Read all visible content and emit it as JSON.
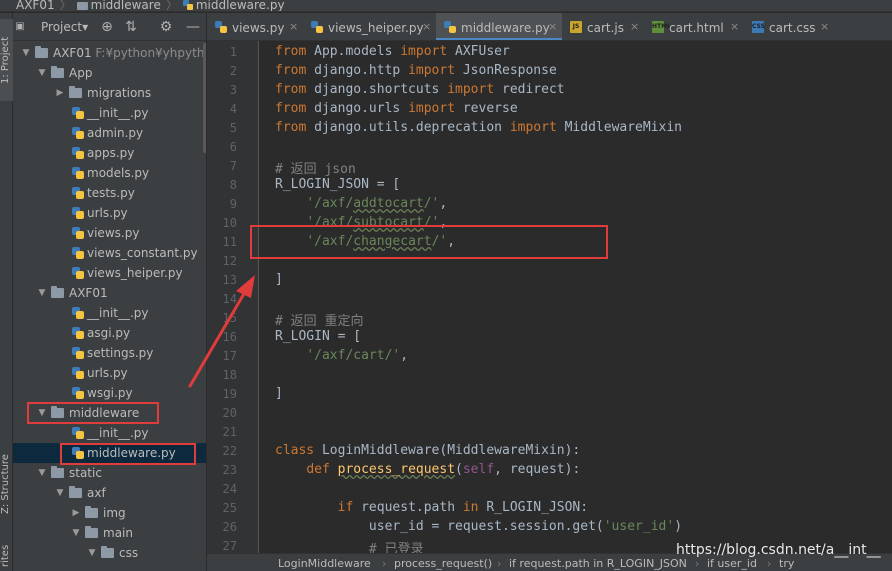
{
  "breadcrumb": {
    "project": "AXF01",
    "folder": "middleware",
    "file": "middleware.py"
  },
  "side_tabs": {
    "project": "1: Project",
    "structure": "Z: Structure",
    "favorites": "rites"
  },
  "project_panel": {
    "title": "Project",
    "title_arrow": "▾",
    "tools": {
      "locate": "⊕",
      "collapse": "⇅",
      "settings": "⚙",
      "hide": "—"
    }
  },
  "tree": [
    {
      "label": "AXF01",
      "path": "F:¥python¥yhpython¥",
      "type": "folder",
      "depth": 0,
      "expanded": true
    },
    {
      "label": "App",
      "type": "folder",
      "depth": 1,
      "expanded": true
    },
    {
      "label": "migrations",
      "type": "folder",
      "depth": 2,
      "expanded": false
    },
    {
      "label": "__init__.py",
      "type": "py",
      "depth": 3
    },
    {
      "label": "admin.py",
      "type": "py",
      "depth": 3
    },
    {
      "label": "apps.py",
      "type": "py",
      "depth": 3
    },
    {
      "label": "models.py",
      "type": "py",
      "depth": 3
    },
    {
      "label": "tests.py",
      "type": "py",
      "depth": 3
    },
    {
      "label": "urls.py",
      "type": "py",
      "depth": 3
    },
    {
      "label": "views.py",
      "type": "py",
      "depth": 3
    },
    {
      "label": "views_constant.py",
      "type": "py",
      "depth": 3
    },
    {
      "label": "views_heiper.py",
      "type": "py",
      "depth": 3
    },
    {
      "label": "AXF01",
      "type": "folder",
      "depth": 1,
      "expanded": true
    },
    {
      "label": "__init__.py",
      "type": "py",
      "depth": 3
    },
    {
      "label": "asgi.py",
      "type": "py",
      "depth": 3
    },
    {
      "label": "settings.py",
      "type": "py",
      "depth": 3
    },
    {
      "label": "urls.py",
      "type": "py",
      "depth": 3
    },
    {
      "label": "wsgi.py",
      "type": "py",
      "depth": 3
    },
    {
      "label": "middleware",
      "type": "folder",
      "depth": 1,
      "expanded": true
    },
    {
      "label": "__init__.py",
      "type": "py",
      "depth": 3
    },
    {
      "label": "middleware.py",
      "type": "py",
      "depth": 3,
      "selected": true
    },
    {
      "label": "static",
      "type": "folder",
      "depth": 1,
      "expanded": true
    },
    {
      "label": "axf",
      "type": "folder",
      "depth": 2,
      "expanded": true
    },
    {
      "label": "img",
      "type": "folder",
      "depth": 3,
      "expanded": false
    },
    {
      "label": "main",
      "type": "folder",
      "depth": 3,
      "expanded": true
    },
    {
      "label": "css",
      "type": "folder",
      "depth": 4,
      "expanded": true
    }
  ],
  "tabs": [
    {
      "label": "views.py",
      "icon": "python-file-icon",
      "active": false
    },
    {
      "label": "views_heiper.py",
      "icon": "python-file-icon",
      "active": false
    },
    {
      "label": "middleware.py",
      "icon": "python-file-icon",
      "active": true
    },
    {
      "label": "cart.js",
      "icon": "js-file-icon",
      "active": false
    },
    {
      "label": "cart.html",
      "icon": "html-file-icon",
      "active": false
    },
    {
      "label": "cart.css",
      "icon": "css-file-icon",
      "active": false
    }
  ],
  "tab_close": "×",
  "code_lines": [
    [
      [
        "kw",
        "from"
      ],
      [
        "p",
        " App.models "
      ],
      [
        "kw",
        "import"
      ],
      [
        "p",
        " AXFUser"
      ]
    ],
    [
      [
        "kw",
        "from"
      ],
      [
        "p",
        " django.http "
      ],
      [
        "kw",
        "import"
      ],
      [
        "p",
        " JsonResponse"
      ]
    ],
    [
      [
        "kw",
        "from"
      ],
      [
        "p",
        " django.shortcuts "
      ],
      [
        "kw",
        "import"
      ],
      [
        "p",
        " redirect"
      ]
    ],
    [
      [
        "kw",
        "from"
      ],
      [
        "p",
        " django.urls "
      ],
      [
        "kw",
        "import"
      ],
      [
        "p",
        " reverse"
      ]
    ],
    [
      [
        "kw",
        "from"
      ],
      [
        "p",
        " django.utils.deprecation "
      ],
      [
        "kw",
        "import"
      ],
      [
        "p",
        " MiddlewareMixin"
      ]
    ],
    [],
    [
      [
        "cm",
        "# 返回 json"
      ]
    ],
    [
      [
        "p",
        "R_LOGIN_JSON = ["
      ]
    ],
    [
      [
        "p",
        "    "
      ],
      [
        "str",
        "'/axf/"
      ],
      [
        "strsq",
        "addtocart"
      ],
      [
        "str",
        "/'"
      ],
      [
        "p",
        ","
      ]
    ],
    [
      [
        "p",
        "    "
      ],
      [
        "str",
        "'/axf/"
      ],
      [
        "strsq",
        "subtocart"
      ],
      [
        "str",
        "/'"
      ],
      [
        "p",
        ","
      ]
    ],
    [
      [
        "p",
        "    "
      ],
      [
        "str",
        "'/axf/"
      ],
      [
        "strsq",
        "changecart"
      ],
      [
        "str",
        "/'"
      ],
      [
        "p",
        ","
      ]
    ],
    [],
    [
      [
        "p",
        "]"
      ]
    ],
    [],
    [
      [
        "cm",
        "# 返回 重定向"
      ]
    ],
    [
      [
        "p",
        "R_LOGIN = ["
      ]
    ],
    [
      [
        "p",
        "    "
      ],
      [
        "str",
        "'/axf/cart/'"
      ],
      [
        "p",
        ","
      ]
    ],
    [],
    [
      [
        "p",
        "]"
      ]
    ],
    [],
    [],
    [
      [
        "kw",
        "class"
      ],
      [
        "p",
        " LoginMiddleware(MiddlewareMixin):"
      ]
    ],
    [
      [
        "p",
        "    "
      ],
      [
        "kw",
        "def"
      ],
      [
        "p",
        " "
      ],
      [
        "fnw",
        "process_request"
      ],
      [
        "p",
        "("
      ],
      [
        "self",
        "self"
      ],
      [
        "p",
        ", request):"
      ]
    ],
    [],
    [
      [
        "p",
        "        "
      ],
      [
        "kw",
        "if"
      ],
      [
        "p",
        " request.path "
      ],
      [
        "kw",
        "in"
      ],
      [
        "p",
        " R_LOGIN_JSON:"
      ]
    ],
    [
      [
        "p",
        "            user_id = request.session.get("
      ],
      [
        "str",
        "'user_id'"
      ],
      [
        "p",
        ")"
      ]
    ],
    [
      [
        "p",
        "            "
      ],
      [
        "cm",
        "# 已登录"
      ]
    ]
  ],
  "status_path": [
    "LoginMiddleware",
    "process_request()",
    "if request.path in R_LOGIN_JSON",
    "if user_id",
    "try"
  ],
  "watermark": "https://blog.csdn.net/a__int__",
  "colors": {
    "annotation": "#e03c3c",
    "keyword": "#cc7832",
    "string": "#6a8759",
    "comment": "#808080",
    "function": "#ffc66d"
  }
}
